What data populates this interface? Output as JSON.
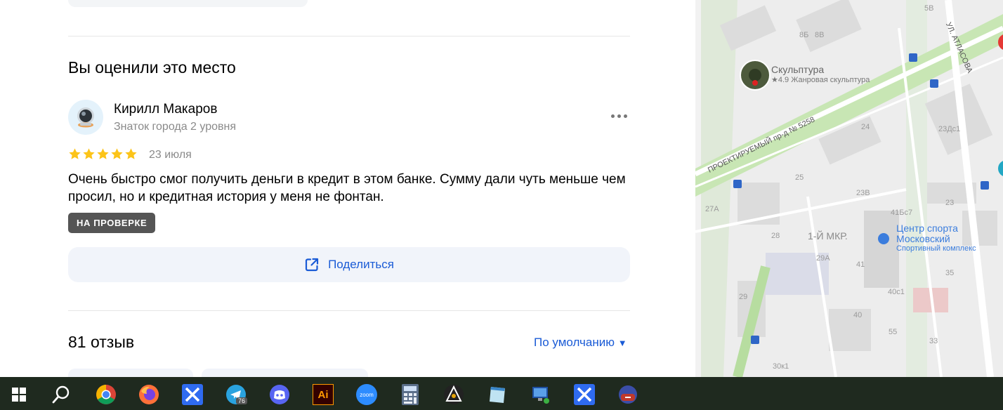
{
  "review_section": {
    "title": "Вы оценили это место",
    "author_name": "Кирилл Макаров",
    "author_level": "Знаток города 2 уровня",
    "rating": 5,
    "date": "23 июля",
    "text": "Очень быстро смог получить деньги в кредит в этом банке. Сумму дали чуть меньше чем просил, но и кредитная история у меня не фонтан.",
    "status_badge": "НА ПРОВЕРКЕ",
    "share_label": "Поделиться"
  },
  "reviews_header": {
    "count_label": "81 отзыв",
    "sort_label": "По умолчанию"
  },
  "colors": {
    "accent": "#1a5bd6",
    "star": "#fcc419",
    "badge_bg": "#555555",
    "taskbar_bg": "#1f2a1f"
  },
  "map": {
    "poi_sculpture": {
      "name": "Скульптура",
      "subtitle": "★4.9 Жанровая скульптура"
    },
    "poi_sport": {
      "name_line1": "Центр спорта",
      "name_line2": "Московский",
      "subtitle": "Спортивный комплекс"
    },
    "street_main": "ПРОЕКТИРУЕМЫЙ пр-д № 5258",
    "street_atlasova": "УЛ. АТЛАСОВА",
    "district": "1-Й МКР.",
    "house_numbers": [
      "8Б",
      "8В",
      "5В",
      "24",
      "23Дс1",
      "25",
      "23В",
      "23",
      "27А",
      "41Бс7",
      "28",
      "29А",
      "41",
      "35",
      "40с1",
      "29",
      "40",
      "55",
      "33",
      "30к1"
    ]
  },
  "taskbar": {
    "icons": [
      "windows-start-icon",
      "search-icon",
      "chrome-icon",
      "firefox-icon",
      "app-x-icon",
      "telegram-icon",
      "discord-icon",
      "illustrator-icon",
      "zoom-icon",
      "calculator-icon",
      "inkscape-icon",
      "notepad-icon",
      "remote-desktop-icon",
      "app-x-icon-2",
      "game-icon"
    ],
    "telegram_badge": "76",
    "illustrator_label": "Ai",
    "zoom_label": "zoom"
  }
}
